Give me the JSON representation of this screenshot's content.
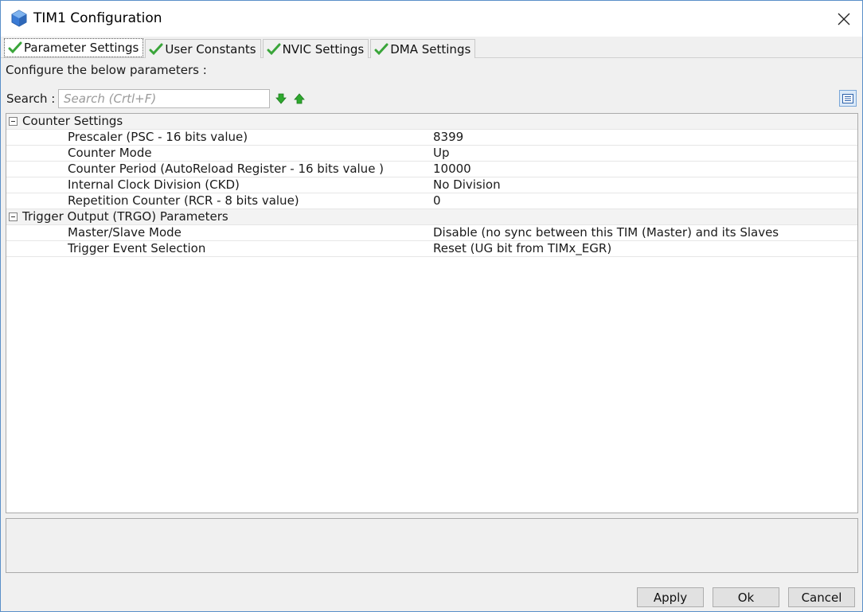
{
  "window": {
    "title": "TIM1 Configuration"
  },
  "tabs": [
    {
      "label": "Parameter Settings",
      "active": true
    },
    {
      "label": "User Constants",
      "active": false
    },
    {
      "label": "NVIC Settings",
      "active": false
    },
    {
      "label": "DMA Settings",
      "active": false
    }
  ],
  "intro": "Configure the below parameters :",
  "search": {
    "label": "Search :",
    "placeholder": "Search (Crtl+F)",
    "value": ""
  },
  "groups": [
    {
      "title": "Counter Settings",
      "params": [
        {
          "name": "Prescaler (PSC - 16 bits value)",
          "value": "8399"
        },
        {
          "name": "Counter Mode",
          "value": "Up"
        },
        {
          "name": "Counter Period (AutoReload Register - 16 bits value )",
          "value": "10000"
        },
        {
          "name": "Internal Clock Division (CKD)",
          "value": "No Division"
        },
        {
          "name": "Repetition Counter (RCR - 8 bits value)",
          "value": "0"
        }
      ]
    },
    {
      "title": "Trigger Output (TRGO) Parameters",
      "params": [
        {
          "name": "Master/Slave Mode",
          "value": "Disable (no sync between this TIM (Master) and its Slaves"
        },
        {
          "name": "Trigger Event Selection",
          "value": "Reset (UG bit from TIMx_EGR)"
        }
      ]
    }
  ],
  "buttons": {
    "apply": "Apply",
    "ok": "Ok",
    "cancel": "Cancel"
  },
  "colors": {
    "check_green": "#3aa53a",
    "arrow_green": "#2ea82e",
    "window_border": "#5a8fc8"
  }
}
